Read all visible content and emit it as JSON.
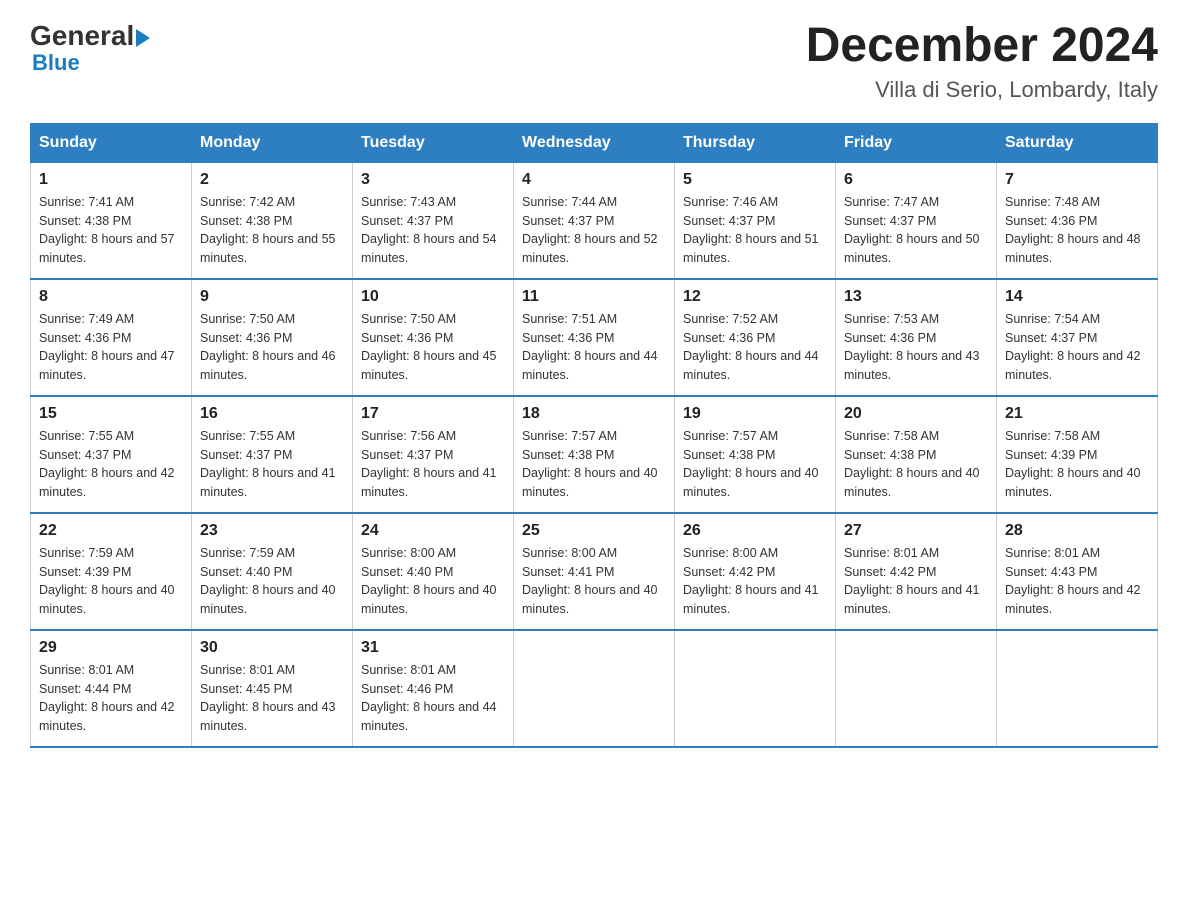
{
  "header": {
    "logo_general": "General",
    "logo_blue": "Blue",
    "month_title": "December 2024",
    "location": "Villa di Serio, Lombardy, Italy"
  },
  "days_of_week": [
    "Sunday",
    "Monday",
    "Tuesday",
    "Wednesday",
    "Thursday",
    "Friday",
    "Saturday"
  ],
  "weeks": [
    [
      {
        "day": "1",
        "sunrise": "7:41 AM",
        "sunset": "4:38 PM",
        "daylight": "8 hours and 57 minutes."
      },
      {
        "day": "2",
        "sunrise": "7:42 AM",
        "sunset": "4:38 PM",
        "daylight": "8 hours and 55 minutes."
      },
      {
        "day": "3",
        "sunrise": "7:43 AM",
        "sunset": "4:37 PM",
        "daylight": "8 hours and 54 minutes."
      },
      {
        "day": "4",
        "sunrise": "7:44 AM",
        "sunset": "4:37 PM",
        "daylight": "8 hours and 52 minutes."
      },
      {
        "day": "5",
        "sunrise": "7:46 AM",
        "sunset": "4:37 PM",
        "daylight": "8 hours and 51 minutes."
      },
      {
        "day": "6",
        "sunrise": "7:47 AM",
        "sunset": "4:37 PM",
        "daylight": "8 hours and 50 minutes."
      },
      {
        "day": "7",
        "sunrise": "7:48 AM",
        "sunset": "4:36 PM",
        "daylight": "8 hours and 48 minutes."
      }
    ],
    [
      {
        "day": "8",
        "sunrise": "7:49 AM",
        "sunset": "4:36 PM",
        "daylight": "8 hours and 47 minutes."
      },
      {
        "day": "9",
        "sunrise": "7:50 AM",
        "sunset": "4:36 PM",
        "daylight": "8 hours and 46 minutes."
      },
      {
        "day": "10",
        "sunrise": "7:50 AM",
        "sunset": "4:36 PM",
        "daylight": "8 hours and 45 minutes."
      },
      {
        "day": "11",
        "sunrise": "7:51 AM",
        "sunset": "4:36 PM",
        "daylight": "8 hours and 44 minutes."
      },
      {
        "day": "12",
        "sunrise": "7:52 AM",
        "sunset": "4:36 PM",
        "daylight": "8 hours and 44 minutes."
      },
      {
        "day": "13",
        "sunrise": "7:53 AM",
        "sunset": "4:36 PM",
        "daylight": "8 hours and 43 minutes."
      },
      {
        "day": "14",
        "sunrise": "7:54 AM",
        "sunset": "4:37 PM",
        "daylight": "8 hours and 42 minutes."
      }
    ],
    [
      {
        "day": "15",
        "sunrise": "7:55 AM",
        "sunset": "4:37 PM",
        "daylight": "8 hours and 42 minutes."
      },
      {
        "day": "16",
        "sunrise": "7:55 AM",
        "sunset": "4:37 PM",
        "daylight": "8 hours and 41 minutes."
      },
      {
        "day": "17",
        "sunrise": "7:56 AM",
        "sunset": "4:37 PM",
        "daylight": "8 hours and 41 minutes."
      },
      {
        "day": "18",
        "sunrise": "7:57 AM",
        "sunset": "4:38 PM",
        "daylight": "8 hours and 40 minutes."
      },
      {
        "day": "19",
        "sunrise": "7:57 AM",
        "sunset": "4:38 PM",
        "daylight": "8 hours and 40 minutes."
      },
      {
        "day": "20",
        "sunrise": "7:58 AM",
        "sunset": "4:38 PM",
        "daylight": "8 hours and 40 minutes."
      },
      {
        "day": "21",
        "sunrise": "7:58 AM",
        "sunset": "4:39 PM",
        "daylight": "8 hours and 40 minutes."
      }
    ],
    [
      {
        "day": "22",
        "sunrise": "7:59 AM",
        "sunset": "4:39 PM",
        "daylight": "8 hours and 40 minutes."
      },
      {
        "day": "23",
        "sunrise": "7:59 AM",
        "sunset": "4:40 PM",
        "daylight": "8 hours and 40 minutes."
      },
      {
        "day": "24",
        "sunrise": "8:00 AM",
        "sunset": "4:40 PM",
        "daylight": "8 hours and 40 minutes."
      },
      {
        "day": "25",
        "sunrise": "8:00 AM",
        "sunset": "4:41 PM",
        "daylight": "8 hours and 40 minutes."
      },
      {
        "day": "26",
        "sunrise": "8:00 AM",
        "sunset": "4:42 PM",
        "daylight": "8 hours and 41 minutes."
      },
      {
        "day": "27",
        "sunrise": "8:01 AM",
        "sunset": "4:42 PM",
        "daylight": "8 hours and 41 minutes."
      },
      {
        "day": "28",
        "sunrise": "8:01 AM",
        "sunset": "4:43 PM",
        "daylight": "8 hours and 42 minutes."
      }
    ],
    [
      {
        "day": "29",
        "sunrise": "8:01 AM",
        "sunset": "4:44 PM",
        "daylight": "8 hours and 42 minutes."
      },
      {
        "day": "30",
        "sunrise": "8:01 AM",
        "sunset": "4:45 PM",
        "daylight": "8 hours and 43 minutes."
      },
      {
        "day": "31",
        "sunrise": "8:01 AM",
        "sunset": "4:46 PM",
        "daylight": "8 hours and 44 minutes."
      },
      null,
      null,
      null,
      null
    ]
  ]
}
